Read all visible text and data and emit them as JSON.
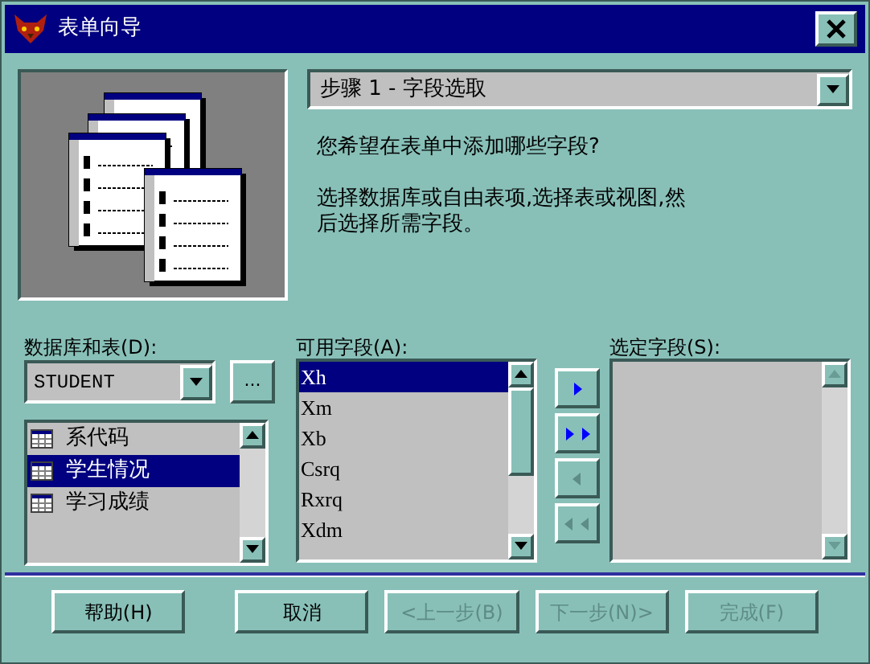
{
  "window": {
    "title": "表单向导"
  },
  "step_select": {
    "value": "步骤 1 - 字段选取"
  },
  "prompt": "您希望在表单中添加哪些字段?",
  "instructions": "选择数据库或自由表项,选择表或视图,然后选择所需字段。",
  "database": {
    "label": "数据库和表(D):",
    "value": "STUDENT",
    "browse": "..."
  },
  "tables": [
    {
      "name": "系代码",
      "selected": false
    },
    {
      "name": "学生情况",
      "selected": true
    },
    {
      "name": "学习成绩",
      "selected": false
    }
  ],
  "available": {
    "label": "可用字段(A):",
    "items": [
      {
        "name": "Xh",
        "selected": true
      },
      {
        "name": "Xm",
        "selected": false
      },
      {
        "name": "Xb",
        "selected": false
      },
      {
        "name": "Csrq",
        "selected": false
      },
      {
        "name": "Rxrq",
        "selected": false
      },
      {
        "name": "Xdm",
        "selected": false
      }
    ]
  },
  "move_buttons": [
    {
      "kind": "add",
      "disabled": false
    },
    {
      "kind": "add_all",
      "disabled": false
    },
    {
      "kind": "remove",
      "disabled": true
    },
    {
      "kind": "remove_all",
      "disabled": true
    }
  ],
  "selected_fields": {
    "label": "选定字段(S):"
  },
  "buttons": [
    {
      "label": "帮助(H)",
      "disabled": false
    },
    {
      "label": "取消",
      "disabled": false
    },
    {
      "label": "<上一步(B)",
      "disabled": true
    },
    {
      "label": "下一步(N)>",
      "disabled": true
    },
    {
      "label": "完成(F)",
      "disabled": true
    }
  ]
}
